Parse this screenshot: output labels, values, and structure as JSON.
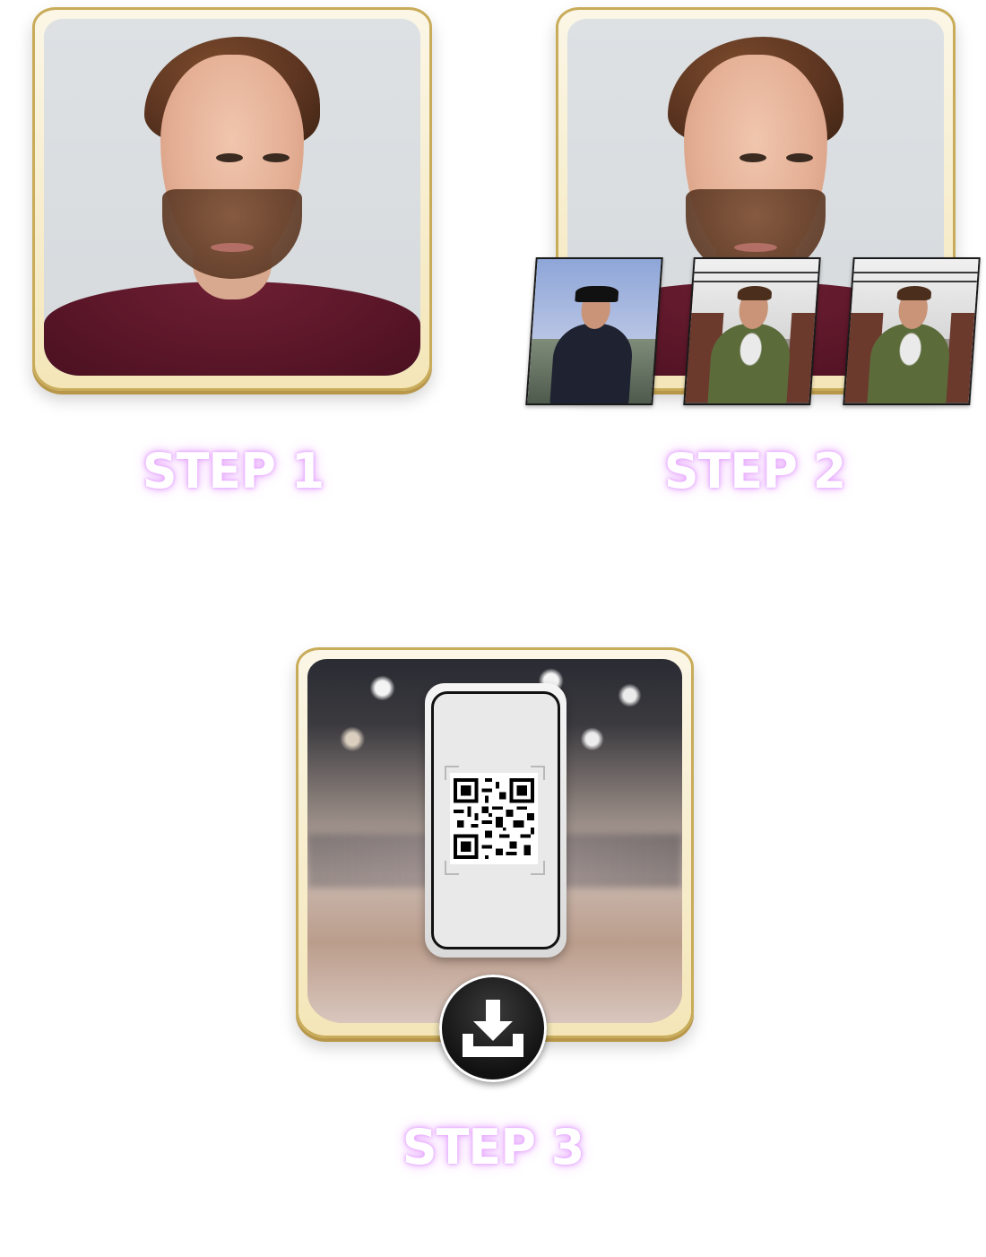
{
  "steps": [
    {
      "title": "STEP 1",
      "caption": ""
    },
    {
      "title": "STEP 2",
      "caption": ""
    },
    {
      "title": "STEP 3",
      "caption": ""
    }
  ],
  "icons": {
    "step3_action": "download-icon",
    "qr": "qr-code-icon"
  },
  "colors": {
    "frame_gold": "#c9ac5a",
    "title_glow": "#e6a3ff",
    "button_dark": "#111111"
  }
}
